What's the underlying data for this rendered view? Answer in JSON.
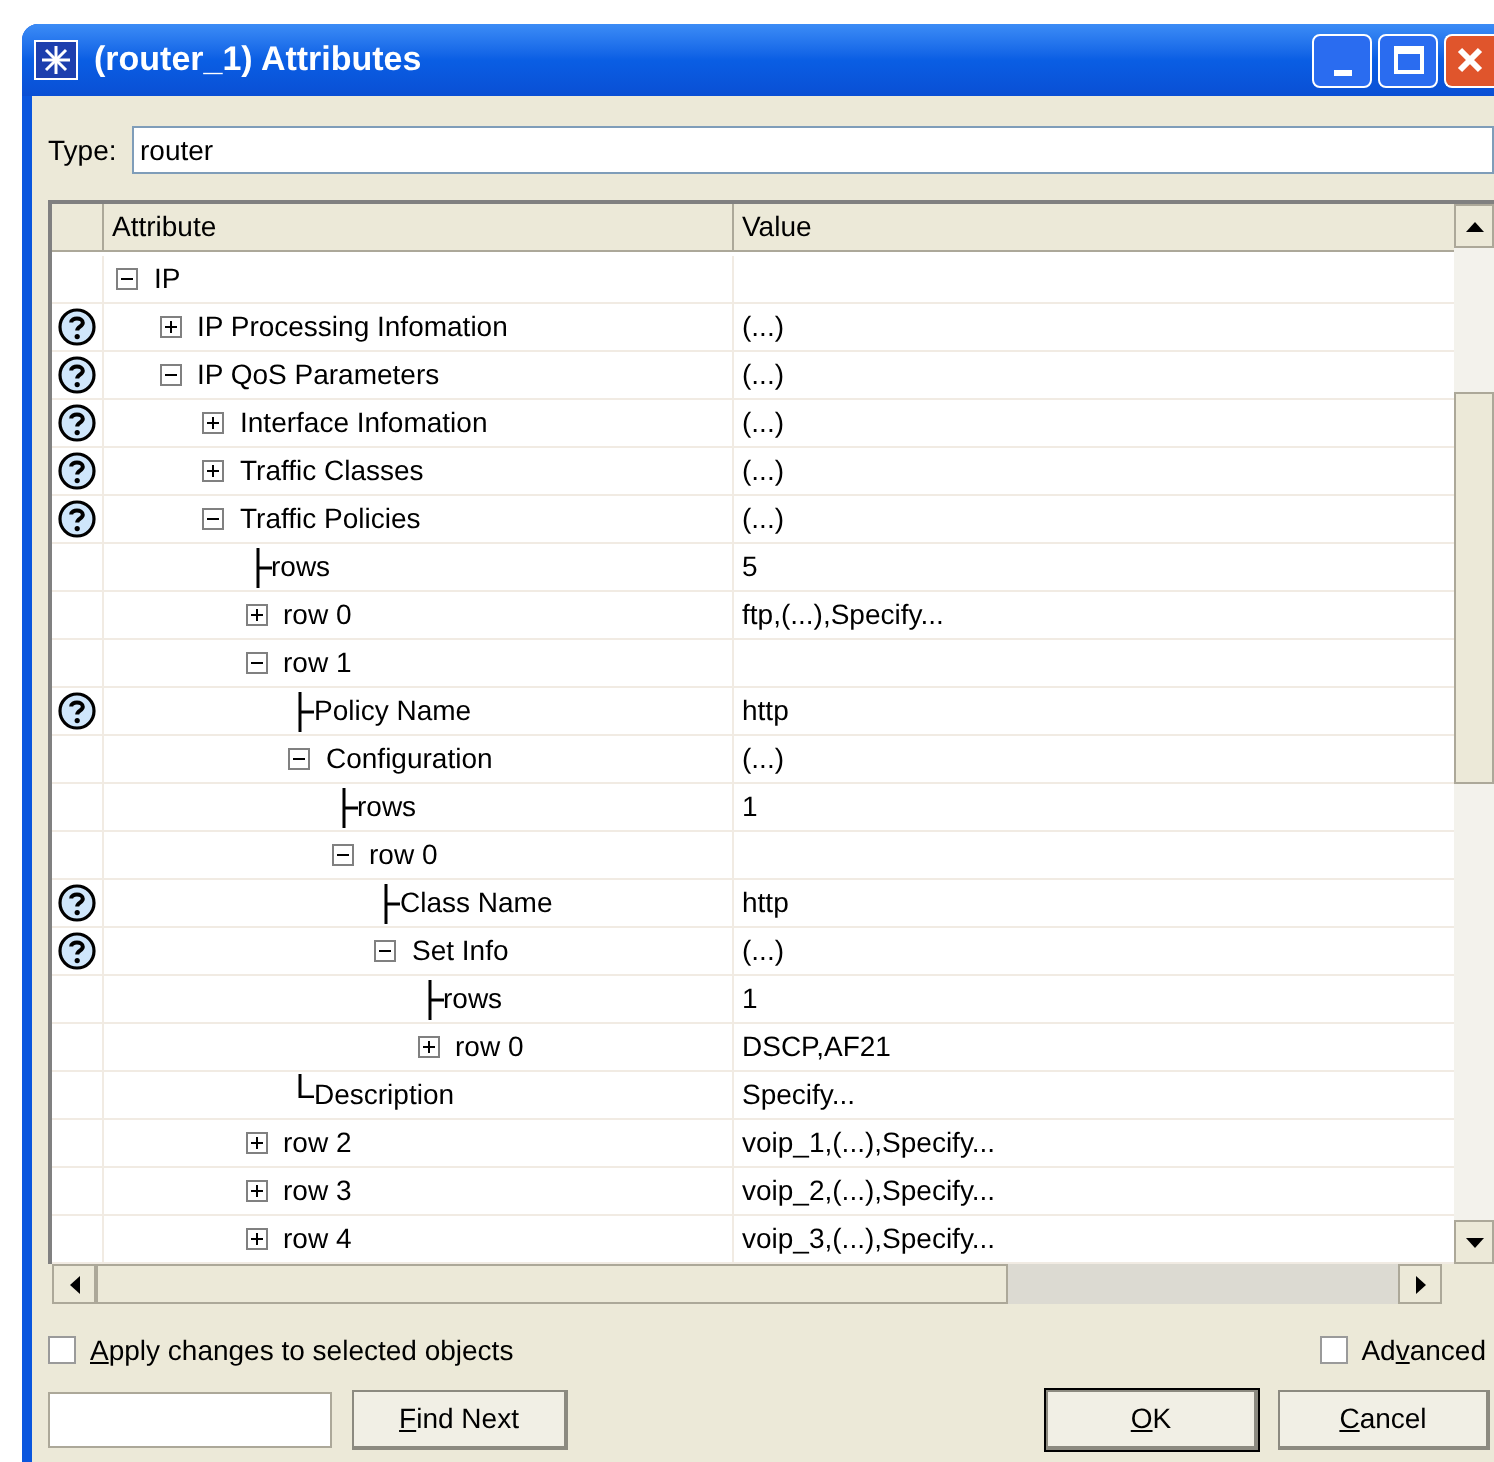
{
  "window": {
    "title": "(router_1) Attributes"
  },
  "type_field": {
    "label": "Type:",
    "value": "router"
  },
  "table": {
    "columns": [
      "Attribute",
      "Value"
    ],
    "rows": [
      {
        "attribute": "IP",
        "kind": "node",
        "expanded": true,
        "help": false,
        "children": [
          {
            "attribute": "IP Processing Infomation",
            "value": "(...)",
            "kind": "node",
            "expanded": false,
            "help": true
          },
          {
            "attribute": "IP QoS Parameters",
            "value": "(...)",
            "kind": "node",
            "expanded": true,
            "help": true,
            "children": [
              {
                "attribute": "Interface Infomation",
                "value": "(...)",
                "kind": "node",
                "expanded": false,
                "help": true
              },
              {
                "attribute": "Traffic Classes",
                "value": "(...)",
                "kind": "node",
                "expanded": false,
                "help": true
              },
              {
                "attribute": "Traffic Policies",
                "value": "(...)",
                "kind": "node",
                "expanded": true,
                "help": true,
                "children": [
                  {
                    "attribute": "rows",
                    "value": "5",
                    "kind": "leaf",
                    "last": false,
                    "help": false
                  },
                  {
                    "attribute": "row 0",
                    "value": "ftp,(...),Specify...",
                    "kind": "node",
                    "expanded": false,
                    "help": false
                  },
                  {
                    "attribute": "row 1",
                    "kind": "node",
                    "expanded": true,
                    "help": false,
                    "children": [
                      {
                        "attribute": "Policy Name",
                        "value": "http",
                        "kind": "leaf",
                        "last": false,
                        "help": true
                      },
                      {
                        "attribute": "Configuration",
                        "value": "(...)",
                        "kind": "node",
                        "expanded": true,
                        "help": false,
                        "children": [
                          {
                            "attribute": "rows",
                            "value": "1",
                            "kind": "leaf",
                            "last": false,
                            "help": false
                          },
                          {
                            "attribute": "row 0",
                            "kind": "node",
                            "expanded": true,
                            "help": false,
                            "children": [
                              {
                                "attribute": "Class Name",
                                "value": "http",
                                "kind": "leaf",
                                "last": false,
                                "help": true
                              },
                              {
                                "attribute": "Set Info",
                                "value": "(...)",
                                "kind": "node",
                                "expanded": true,
                                "help": true,
                                "children": [
                                  {
                                    "attribute": "rows",
                                    "value": "1",
                                    "kind": "leaf",
                                    "last": false,
                                    "help": false
                                  },
                                  {
                                    "attribute": "row 0",
                                    "value": "DSCP,AF21",
                                    "kind": "node",
                                    "expanded": false,
                                    "help": false
                                  }
                                ]
                              }
                            ]
                          }
                        ]
                      },
                      {
                        "attribute": "Description",
                        "value": "Specify...",
                        "kind": "leaf",
                        "last": true,
                        "help": false
                      }
                    ]
                  },
                  {
                    "attribute": "row 2",
                    "value": "voip_1,(...),Specify...",
                    "kind": "node",
                    "expanded": false,
                    "help": false
                  },
                  {
                    "attribute": "row 3",
                    "value": "voip_2,(...),Specify...",
                    "kind": "node",
                    "expanded": false,
                    "help": false
                  },
                  {
                    "attribute": "row 4",
                    "value": "voip_3,(...),Specify...",
                    "kind": "node",
                    "expanded": false,
                    "help": false
                  }
                ]
              }
            ]
          }
        ]
      }
    ]
  },
  "apply_checkbox": {
    "label": "Apply changes to selected objects",
    "checked": false
  },
  "advanced_checkbox": {
    "label": "Advanced",
    "checked": false
  },
  "buttons": [
    {
      "label": "Find Next",
      "default": false
    },
    {
      "label": "OK",
      "default": true
    },
    {
      "label": "Cancel",
      "default": false
    }
  ]
}
